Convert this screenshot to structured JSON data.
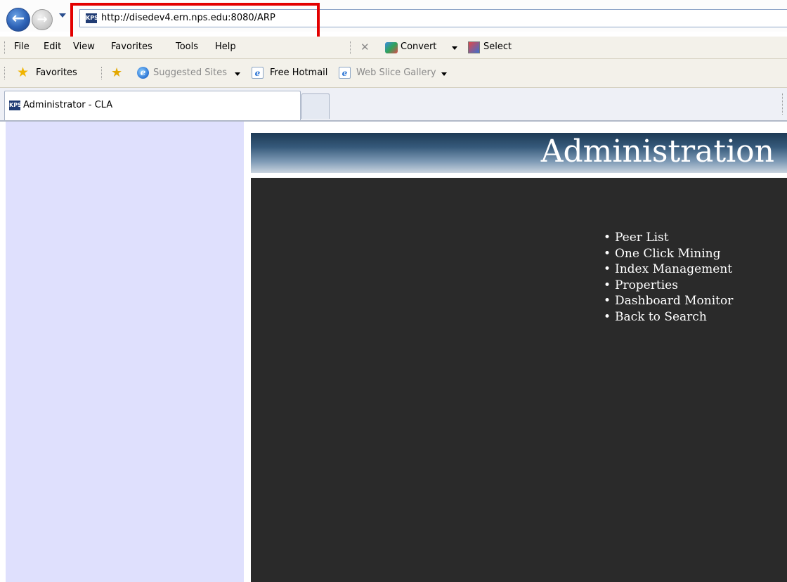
{
  "browser": {
    "address": {
      "url": "http://disedev4.ern.nps.edu:8080/ARP",
      "site_icon_text": "KPS"
    },
    "menu": {
      "items": [
        "File",
        "Edit",
        "View",
        "Favorites",
        "Tools",
        "Help"
      ],
      "stop_symbol": "✕",
      "convert_label": "Convert",
      "select_label": "Select"
    },
    "favorites_bar": {
      "favorites_label": "Favorites",
      "links": [
        "Suggested Sites",
        "Free Hotmail",
        "Web Slice Gallery"
      ]
    },
    "tab": {
      "title": "Administrator - CLA",
      "site_icon_text": "KPS"
    }
  },
  "page": {
    "header_title": "Administration",
    "menu_items": [
      "Peer List",
      "One Click Mining",
      "Index Management",
      "Properties",
      "Dashboard Monitor",
      "Back to Search"
    ],
    "bullet": "•"
  },
  "colors": {
    "highlight_box": "#e30000",
    "left_panel": "#dfe0fd",
    "dark_panel": "#2a2a2a",
    "banner_top": "#1e3a55",
    "banner_bottom": "#c9d4df"
  },
  "icons": {
    "back": "back-arrow-icon",
    "forward": "forward-arrow-icon",
    "favorites": "star-icon",
    "add_favorites": "add-favorites-icon",
    "ie": "ie-icon"
  }
}
